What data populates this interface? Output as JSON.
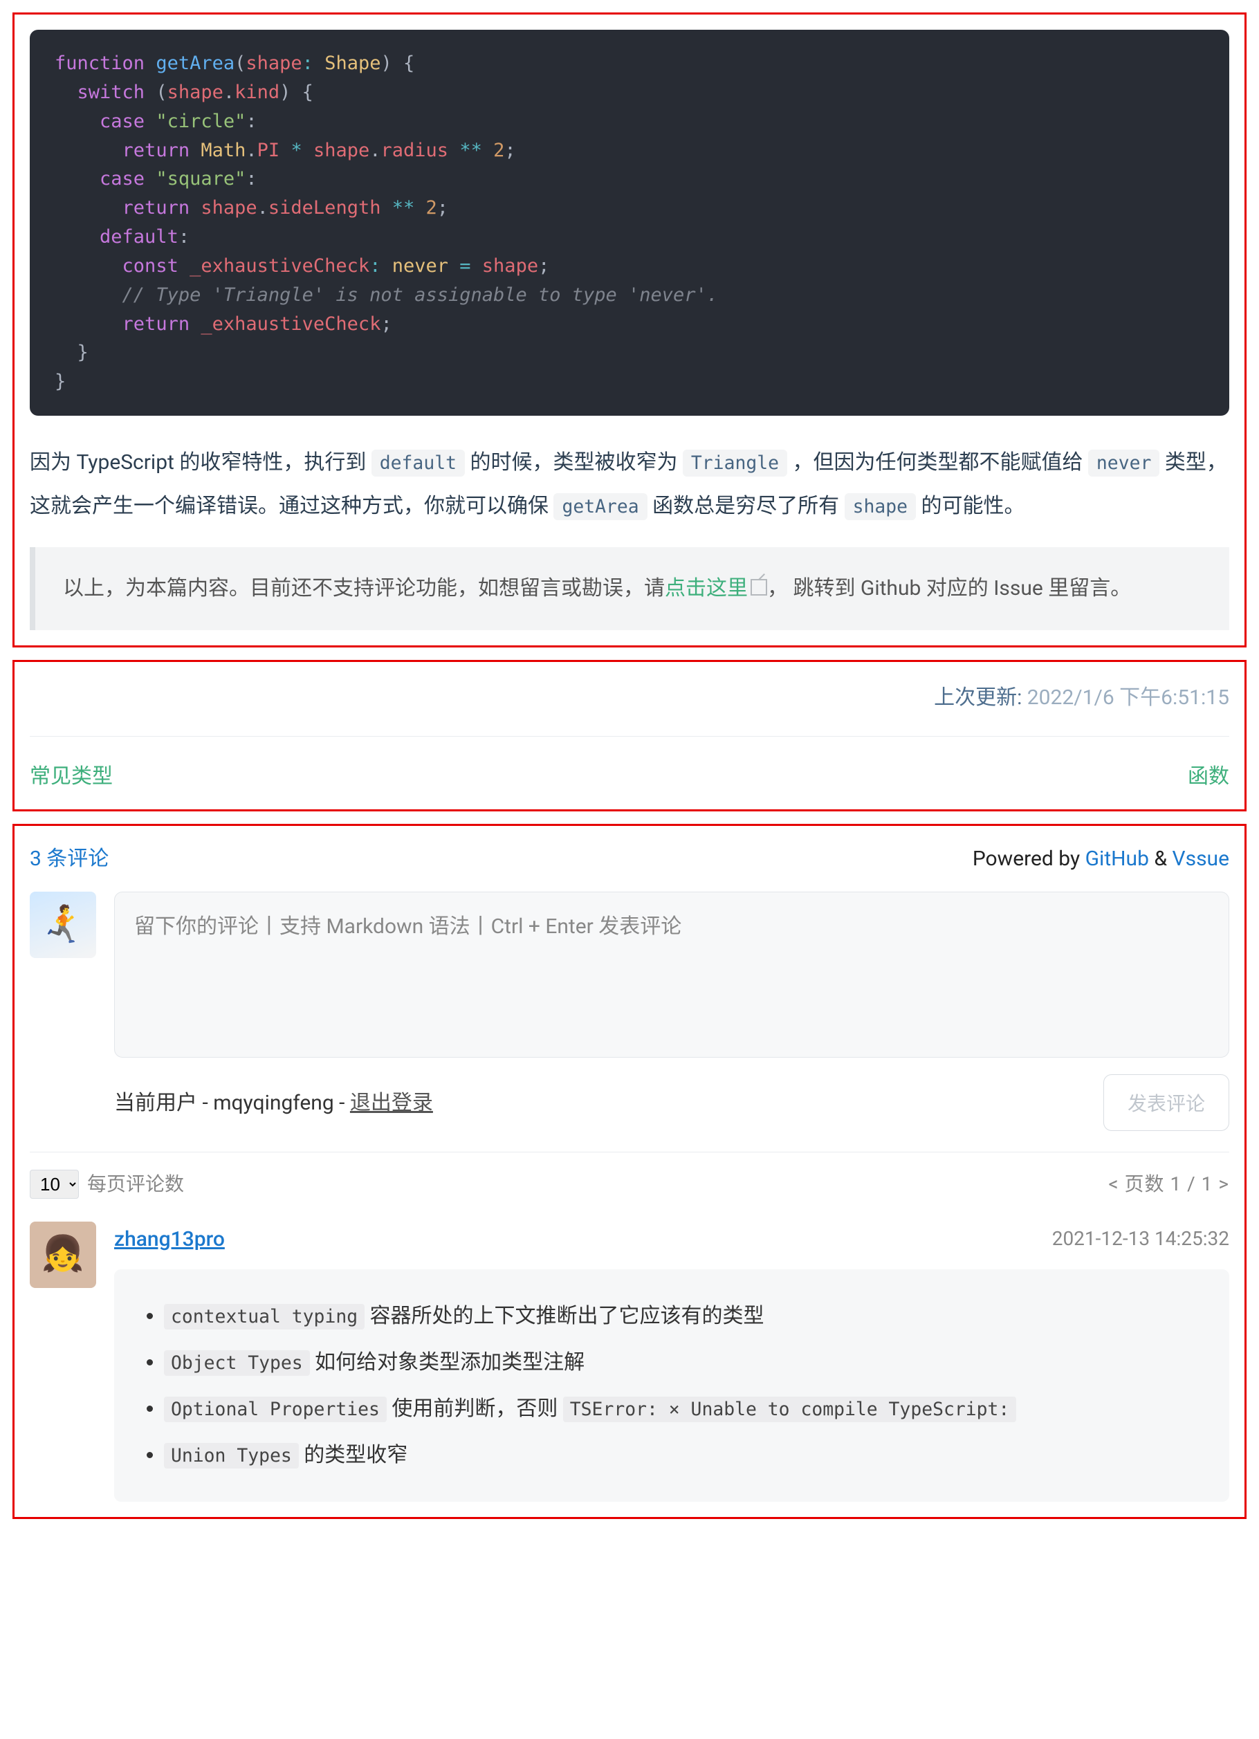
{
  "code_block": "function getArea(shape: Shape) {\n  switch (shape.kind) {\n    case \"circle\":\n      return Math.PI * shape.radius ** 2;\n    case \"square\":\n      return shape.sideLength ** 2;\n    default:\n      const _exhaustiveCheck: never = shape;\n      // Type 'Triangle' is not assignable to type 'never'.\n      return _exhaustiveCheck;\n  }\n}",
  "paragraph": {
    "t1": "因为 TypeScript 的收窄特性，执行到 ",
    "c1": "default",
    "t2": " 的时候，类型被收窄为 ",
    "c2": "Triangle",
    "t3": " ，但因为任何类型都不能赋值给 ",
    "c3": "never",
    "t4": " 类型，这就会产生一个编译错误。通过这种方式，你就可以确保 ",
    "c4": "getArea",
    "t5": " 函数总是穷尽了所有 ",
    "c5": "shape",
    "t6": " 的可能性。"
  },
  "blockquote": {
    "t1": "以上，为本篇内容。目前还不支持评论功能，如想留言或勘误，请",
    "link": "点击这里",
    "t2": "， 跳转到 Github 对应的 Issue 里留言。"
  },
  "meta": {
    "label": "上次更新: ",
    "value": "2022/1/6 下午6:51:15"
  },
  "nav": {
    "prev": "常见类型",
    "next": "函数"
  },
  "comments": {
    "count_label": "3 条评论",
    "powered_prefix": "Powered by ",
    "powered_github": "GitHub",
    "powered_amp": " & ",
    "powered_vssue": "Vssue",
    "placeholder": "留下你的评论丨支持 Markdown 语法丨Ctrl + Enter 发表评论",
    "current_user_prefix": "当前用户 - ",
    "current_user": "mqyqingfeng",
    "current_user_sep": " - ",
    "logout": "退出登录",
    "submit": "发表评论",
    "perpage_value": "10",
    "perpage_label": "每页评论数",
    "pager_text": "<  页数 1 / 1  >"
  },
  "comment1": {
    "author": "zhang13pro",
    "date": "2021-12-13 14:25:32",
    "items": [
      {
        "code": "contextual typing",
        "text": " 容器所处的上下文推断出了它应该有的类型"
      },
      {
        "code": "Object Types",
        "text": " 如何给对象类型添加类型注解"
      },
      {
        "code": "Optional Properties",
        "text": " 使用前判断，否则 ",
        "code2": "TSError: ⨯ Unable to compile TypeScript:"
      },
      {
        "code": "Union Types",
        "text": " 的类型收窄"
      }
    ]
  }
}
